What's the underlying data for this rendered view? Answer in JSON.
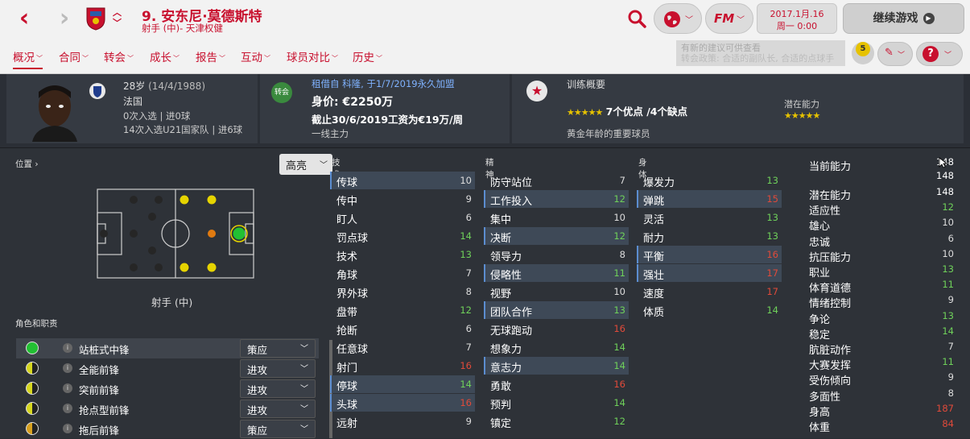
{
  "header": {
    "title": "9. 安东尼·莫德斯特",
    "subtitle": "射手 (中)- 天津权健",
    "date_line1": "2017.1月.16",
    "date_line2": "周一 0:00",
    "continue_label": "继续游戏",
    "fm_label": "FM"
  },
  "tabs": [
    "概况",
    "合同",
    "转会",
    "成长",
    "报告",
    "互动",
    "球员对比",
    "历史"
  ],
  "notification": {
    "line1": "有新的建议可供查看",
    "line2": "转会政策: 合适的副队长, 合适的点球手",
    "count": "5"
  },
  "bio": {
    "age": "28岁",
    "dob": "(14/4/1988)",
    "nation": "法国",
    "caps": "0次入选 | 进0球",
    "u21_caps": "14次入选U21国家队 | 进6球"
  },
  "contract": {
    "badge_label": "转会",
    "loan": "租借自 科隆, 于1/7/2019永久加盟",
    "value": "身价: €2250万",
    "wage": "截止30/6/2019工资为€19万/周",
    "status": "一线主力"
  },
  "training": {
    "title": "训练概要",
    "strengths": "7个优点 /4个缺点",
    "potential_label": "潜在能力",
    "description": "黄金年龄的重要球员",
    "current_stars": 5,
    "potential_stars": 5
  },
  "positions": {
    "label": "位置",
    "highlight": "高亮",
    "role": "射手 (中)",
    "roles_label": "角色和职责"
  },
  "roles": [
    {
      "name": "站桩式中锋",
      "duty": "策应",
      "color": "#22c033"
    },
    {
      "name": "全能前锋",
      "duty": "进攻",
      "color": "#d6d61e"
    },
    {
      "name": "突前前锋",
      "duty": "进攻",
      "color": "#d6d61e"
    },
    {
      "name": "抢点型前锋",
      "duty": "进攻",
      "color": "#d6d61e"
    },
    {
      "name": "拖后前锋",
      "duty": "策应",
      "color": "#d6a01e"
    }
  ],
  "technical": {
    "label": "技术",
    "attributes": [
      {
        "name": "传球",
        "value": "10",
        "color": "#dddddd",
        "hl": true
      },
      {
        "name": "传中",
        "value": "9",
        "color": "#dddddd",
        "hl": false
      },
      {
        "name": "盯人",
        "value": "6",
        "color": "#dddddd",
        "hl": false
      },
      {
        "name": "罚点球",
        "value": "14",
        "color": "#6fd15a",
        "hl": false
      },
      {
        "name": "技术",
        "value": "13",
        "color": "#6fd15a",
        "hl": false
      },
      {
        "name": "角球",
        "value": "7",
        "color": "#dddddd",
        "hl": false
      },
      {
        "name": "界外球",
        "value": "8",
        "color": "#dddddd",
        "hl": false
      },
      {
        "name": "盘带",
        "value": "12",
        "color": "#6fd15a",
        "hl": false
      },
      {
        "name": "抢断",
        "value": "6",
        "color": "#dddddd",
        "hl": false
      },
      {
        "name": "任意球",
        "value": "7",
        "color": "#dddddd",
        "hl": false
      },
      {
        "name": "射门",
        "value": "16",
        "color": "#e04a3a",
        "hl": false
      },
      {
        "name": "停球",
        "value": "14",
        "color": "#6fd15a",
        "hl": true
      },
      {
        "name": "头球",
        "value": "16",
        "color": "#e04a3a",
        "hl": true
      },
      {
        "name": "远射",
        "value": "9",
        "color": "#dddddd",
        "hl": false
      }
    ]
  },
  "mental": {
    "label": "精神",
    "attributes": [
      {
        "name": "防守站位",
        "value": "7",
        "color": "#dddddd",
        "hl": false
      },
      {
        "name": "工作投入",
        "value": "12",
        "color": "#6fd15a",
        "hl": true
      },
      {
        "name": "集中",
        "value": "10",
        "color": "#dddddd",
        "hl": false
      },
      {
        "name": "决断",
        "value": "12",
        "color": "#6fd15a",
        "hl": true
      },
      {
        "name": "领导力",
        "value": "8",
        "color": "#dddddd",
        "hl": false
      },
      {
        "name": "侵略性",
        "value": "11",
        "color": "#6fd15a",
        "hl": true
      },
      {
        "name": "视野",
        "value": "10",
        "color": "#dddddd",
        "hl": false
      },
      {
        "name": "团队合作",
        "value": "13",
        "color": "#6fd15a",
        "hl": true
      },
      {
        "name": "无球跑动",
        "value": "16",
        "color": "#e04a3a",
        "hl": false
      },
      {
        "name": "想象力",
        "value": "14",
        "color": "#6fd15a",
        "hl": false
      },
      {
        "name": "意志力",
        "value": "14",
        "color": "#6fd15a",
        "hl": true
      },
      {
        "name": "勇敢",
        "value": "16",
        "color": "#e04a3a",
        "hl": false
      },
      {
        "name": "预判",
        "value": "14",
        "color": "#6fd15a",
        "hl": false
      },
      {
        "name": "镇定",
        "value": "12",
        "color": "#6fd15a",
        "hl": false
      }
    ]
  },
  "physical": {
    "label": "身体",
    "attributes": [
      {
        "name": "爆发力",
        "value": "13",
        "color": "#6fd15a",
        "hl": false
      },
      {
        "name": "弹跳",
        "value": "15",
        "color": "#e04a3a",
        "hl": true
      },
      {
        "name": "灵活",
        "value": "13",
        "color": "#6fd15a",
        "hl": false
      },
      {
        "name": "耐力",
        "value": "13",
        "color": "#6fd15a",
        "hl": false
      },
      {
        "name": "平衡",
        "value": "16",
        "color": "#e04a3a",
        "hl": true
      },
      {
        "name": "强壮",
        "value": "17",
        "color": "#e04a3a",
        "hl": true
      },
      {
        "name": "速度",
        "value": "17",
        "color": "#e04a3a",
        "hl": false
      },
      {
        "name": "体质",
        "value": "14",
        "color": "#6fd15a",
        "hl": false
      }
    ]
  },
  "hidden": {
    "current_ability_label": "当前能力",
    "current_ability_values": [
      "148",
      "148"
    ],
    "attributes": [
      {
        "name": "潜在能力",
        "value": "148",
        "color": "#ffffff"
      },
      {
        "name": "适应性",
        "value": "12",
        "color": "#6fd15a"
      },
      {
        "name": "雄心",
        "value": "10",
        "color": "#dddddd"
      },
      {
        "name": "忠诚",
        "value": "6",
        "color": "#dddddd"
      },
      {
        "name": "抗压能力",
        "value": "10",
        "color": "#dddddd"
      },
      {
        "name": "职业",
        "value": "13",
        "color": "#6fd15a"
      },
      {
        "name": "体育道德",
        "value": "11",
        "color": "#6fd15a"
      },
      {
        "name": "情绪控制",
        "value": "9",
        "color": "#dddddd"
      },
      {
        "name": "争论",
        "value": "13",
        "color": "#6fd15a"
      },
      {
        "name": "稳定",
        "value": "14",
        "color": "#6fd15a"
      },
      {
        "name": "肮脏动作",
        "value": "7",
        "color": "#dddddd"
      },
      {
        "name": "大赛发挥",
        "value": "11",
        "color": "#6fd15a"
      },
      {
        "name": "受伤倾向",
        "value": "9",
        "color": "#dddddd"
      },
      {
        "name": "多面性",
        "value": "8",
        "color": "#dddddd"
      },
      {
        "name": "身高",
        "value": "187",
        "color": "#e04a3a"
      },
      {
        "name": "体重",
        "value": "84",
        "color": "#e04a3a"
      }
    ]
  },
  "colors": {
    "accent": "#c8102e",
    "good": "#6fd15a",
    "great": "#e04a3a"
  }
}
